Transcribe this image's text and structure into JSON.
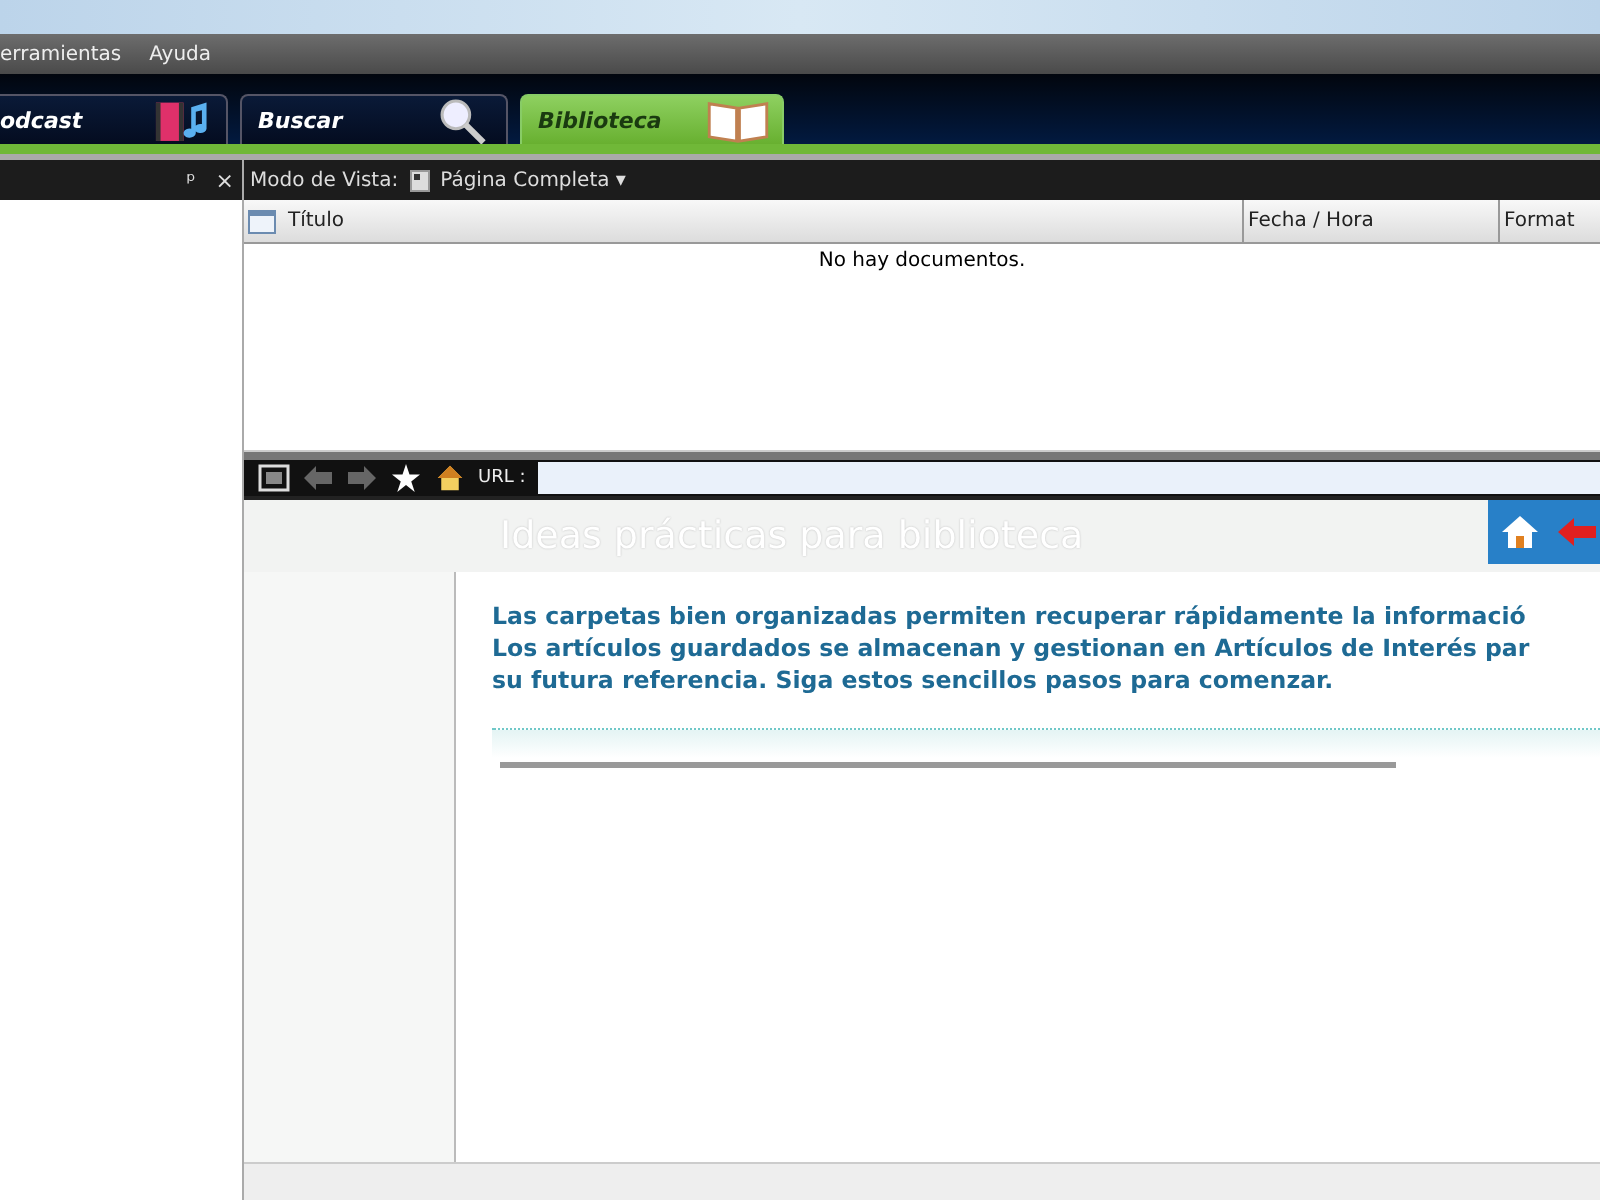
{
  "menu": [
    "erramientas",
    "Ayuda"
  ],
  "tabs": [
    {
      "label": "odcast",
      "selected": false
    },
    {
      "label": "Buscar",
      "selected": false
    },
    {
      "label": "Biblioteca",
      "selected": true
    }
  ],
  "side_panel": {
    "pin": "ᵖ",
    "close": "×"
  },
  "view_toolbar": {
    "label": "Modo de Vista:",
    "mode": "Página Completa",
    "caret": "▾"
  },
  "table": {
    "columns": [
      "Título",
      "Fecha / Hora",
      "Format"
    ],
    "empty": "No hay documentos."
  },
  "browser": {
    "url_label": "URL :"
  },
  "page": {
    "title": "Ideas prácticas para biblioteca",
    "lines": [
      "Las carpetas bien organizadas permiten recuperar rápidamente la informació",
      "Los artículos guardados se almacenan y gestionan en Artículos de Interés par",
      "su futura referencia. Siga estos sencillos pasos para comenzar."
    ]
  }
}
